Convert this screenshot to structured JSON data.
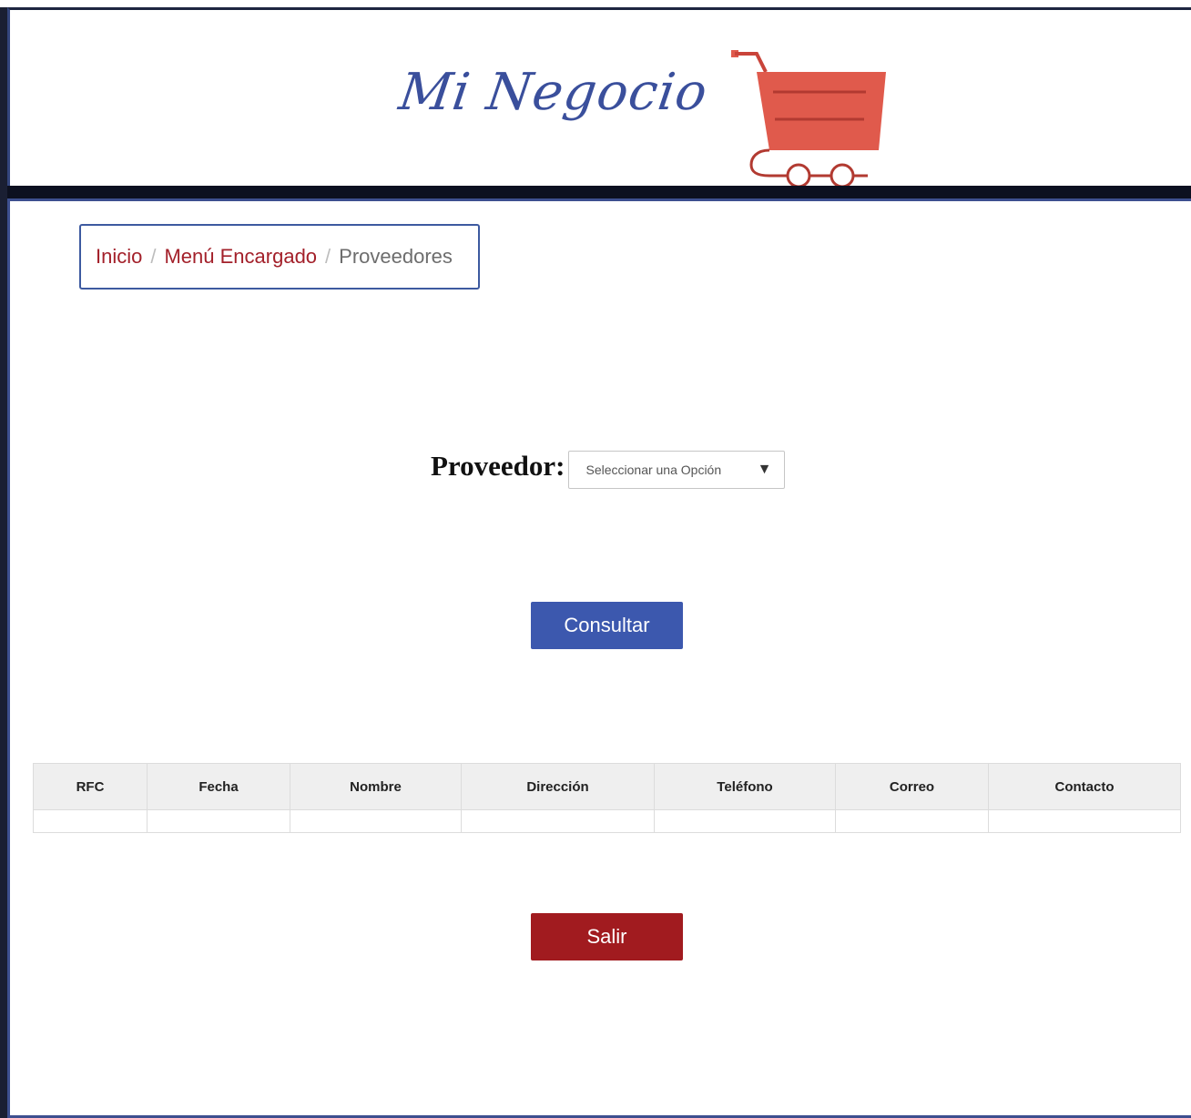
{
  "header": {
    "brand": "Mi Negocio",
    "colors": {
      "brand_text": "#3a4f9c",
      "cart": "#e05a4c",
      "frame": "#3d4f8f"
    }
  },
  "breadcrumb": {
    "items": [
      {
        "label": "Inicio"
      },
      {
        "label": "Menú Encargado"
      },
      {
        "label": "Proveedores"
      }
    ],
    "separator": "/"
  },
  "form": {
    "provider_label": "Proveedor:",
    "select": {
      "selected": "Seleccionar una Opción",
      "arrow": "▼"
    }
  },
  "buttons": {
    "consultar": "Consultar",
    "salir": "Salir"
  },
  "table": {
    "headers": [
      "RFC",
      "Fecha",
      "Nombre",
      "Dirección",
      "Teléfono",
      "Correo",
      "Contacto"
    ],
    "rows": [
      [
        "",
        "",
        "",
        "",
        "",
        "",
        ""
      ]
    ]
  },
  "colors": {
    "primary_button": "#3c58ae",
    "danger_button": "#a11b1f",
    "breadcrumb_link": "#a3202a"
  }
}
